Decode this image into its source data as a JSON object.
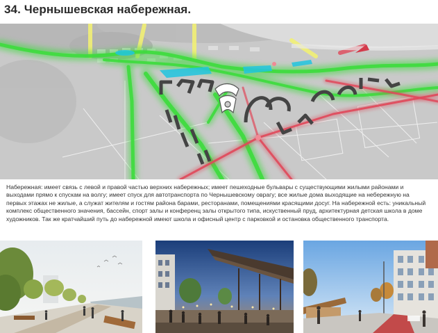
{
  "page": {
    "title": "34. Чернышевская набережная."
  },
  "description": {
    "text": "Набережная: имеет связь с левой и правой частью верхних набережных; имеет пешеходные бульвары с существующими жилыми районами и выходами прямо к спускам на волгу; имеет спуск для автотранспорта по Чернышевскому оврагу; все жилые дома выходящие на небережную на первых этажах не жилые, а служат жителям и гостям района барами, ресторанами, помещениями красящими досуг. На набережной есть: уникальный комплекс общественного значения, бассейн, спорт залы и конференц залы открытого типа, искуственный пруд, архитектурная детская школа в доме художников. Так же кратчайший путь до набережной имеют школа и офисный центр с парковкой и остановка общественного транспорта."
  },
  "map": {
    "colors": {
      "background": "#c9c9c9",
      "river": "#dcdcdc",
      "pedestrian": "#3ddc3d",
      "vehicle": "#e0485a",
      "secondary": "#f2f075",
      "water": "#22c5e0",
      "building": "#444444"
    }
  },
  "photos": [
    {
      "subject": "embankment promenade rendering"
    },
    {
      "subject": "evening public square with pavilion rendering"
    },
    {
      "subject": "street with market stalls rendering"
    }
  ]
}
